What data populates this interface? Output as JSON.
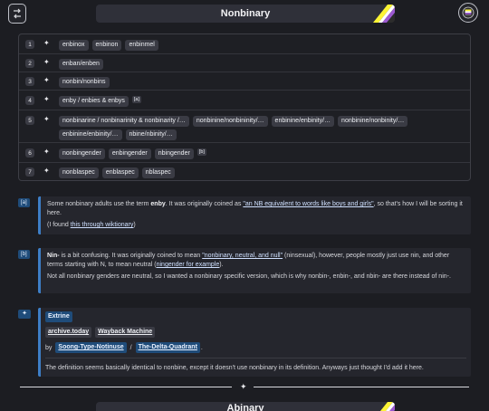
{
  "header": {
    "title": "Nonbinary",
    "menu_icon": "list-icon",
    "flag_icon": "pride-flag-icon"
  },
  "flag_colors": [
    "#fcf434",
    "#ffffff",
    "#9c59d1",
    "#2c2c2c"
  ],
  "terms": [
    {
      "num": "1",
      "items": [
        "enbinox",
        "enbinon",
        "enbinmel"
      ],
      "footnote": ""
    },
    {
      "num": "2",
      "items": [
        "enban/enben"
      ],
      "footnote": ""
    },
    {
      "num": "3",
      "items": [
        "nonbin/nonbins"
      ],
      "footnote": ""
    },
    {
      "num": "4",
      "items": [
        "enby / enbies & enbys"
      ],
      "footnote": "[a]"
    },
    {
      "num": "5",
      "items": [
        "nonbinarine / nonbinarinity & nonbinarity /…",
        "nonbinine/nonbininity/…",
        "enbinine/enbinity/…",
        "nonbinine/nonbinity/…",
        "enbinine/enbinity/…",
        "nbine/nbinity/…"
      ],
      "footnote": ""
    },
    {
      "num": "6",
      "items": [
        "nonbingender",
        "enbingender",
        "nbingender"
      ],
      "footnote": "[b]"
    },
    {
      "num": "7",
      "items": [
        "nonblaspec",
        "enblaspec",
        "nblaspec"
      ],
      "footnote": ""
    }
  ],
  "notes": {
    "a": {
      "badge": "[a]",
      "line1_before": "Some nonbinary adults use the term ",
      "line1_bold": "enby",
      "line1_mid": ". It was originally coined as ",
      "line1_link": "\"an NB equivalent to words like boys and girls\"",
      "line1_after": ", so that's how I will be sorting it here.",
      "line2_before": "(I found ",
      "line2_link": "this through wiktionary",
      "line2_after": ")"
    },
    "b": {
      "badge": "[b]",
      "line1_bold": "Nin-",
      "line1_mid": " is a bit confusing. It was originally coined to mean ",
      "line1_link": "\"nonbinary, neutral, and null\"",
      "line1_mid2": " (ninsexual), however, people mostly just use nin, and other terms starting with N, to mean neutral (",
      "line1_link2": "ningender for example",
      "line1_after": ").",
      "line2": "Not all nonbinary genders are neutral, so I wanted a nonbinary specific version, which is why nonbin-, enbin-, and nbin- are there instead of nin-."
    }
  },
  "entry": {
    "badge": "✦",
    "title": "Extrine",
    "archive_label": "archive.today",
    "wayback_label": "Wayback Machine",
    "by_label": "by",
    "author1": "Soong-Type-Notinuse",
    "separator": "/",
    "author2": "The-Delta-Quadrant",
    "trailing": ".",
    "description": "The definition seems basically identical to nonbine, except it doesn't use nonbinary in its definition. Anyways just thought I'd add it here."
  },
  "divider_glyph": "✦",
  "next_section": {
    "title": "Abinary"
  }
}
